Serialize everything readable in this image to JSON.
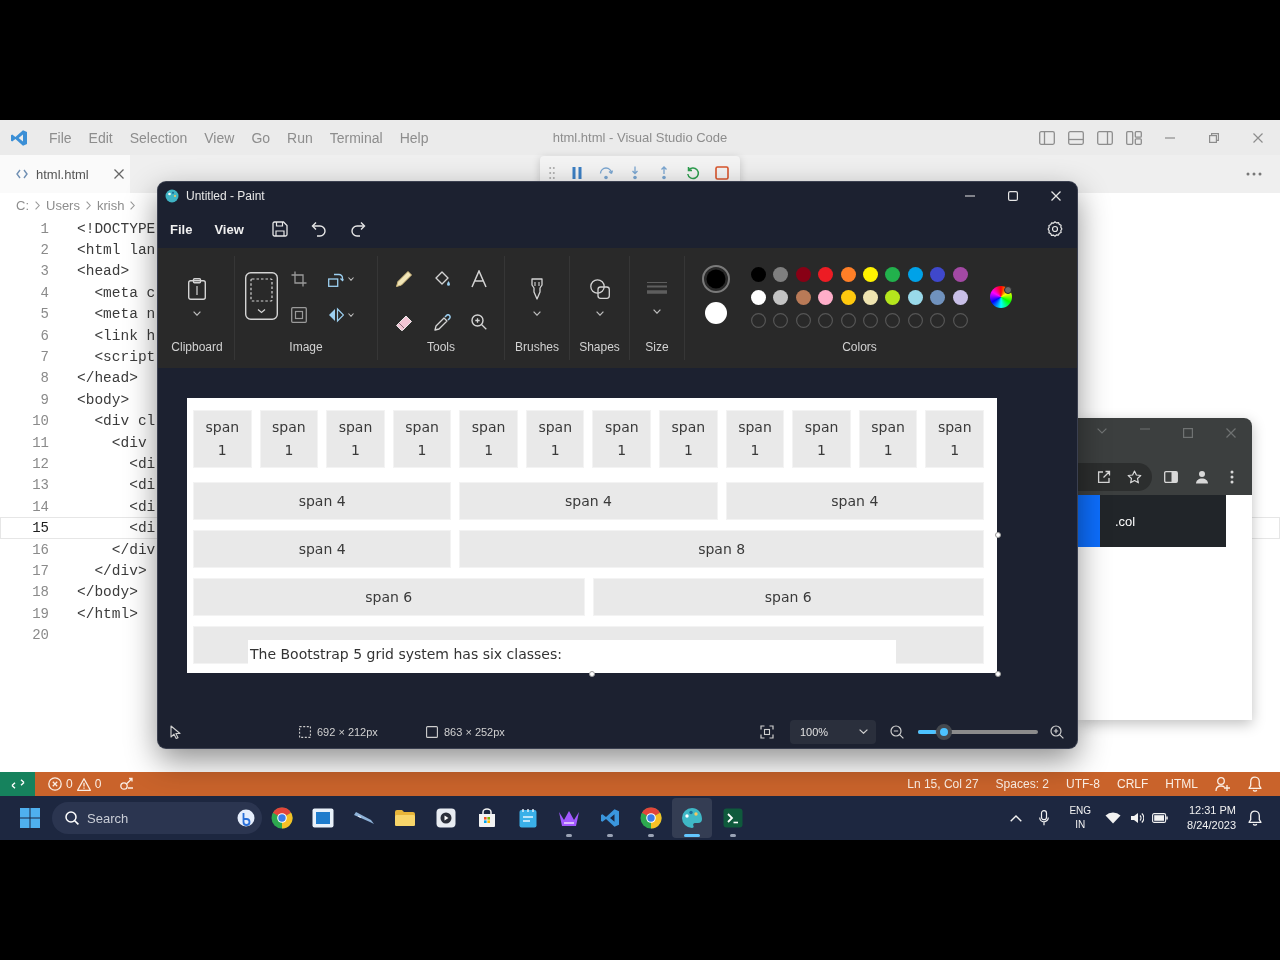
{
  "editor": {
    "menu": [
      "File",
      "Edit",
      "Selection",
      "View",
      "Go",
      "Run",
      "Terminal",
      "Help"
    ],
    "title": "html.html - Visual Studio Code",
    "tabs": [
      {
        "label": "html.html",
        "selected": true
      }
    ],
    "breadcrumb": [
      "C:",
      "Users",
      "krish"
    ],
    "lines": [
      {
        "number": "1",
        "code": "<!DOCTYPE",
        "current": false
      },
      {
        "number": "2",
        "code": "<html lan",
        "current": false
      },
      {
        "number": "3",
        "code": "<head>",
        "current": false,
        "children": [
          {
            "number": "4",
            "code": "<meta c",
            "current": false
          },
          {
            "number": "5",
            "code": "<meta n",
            "current": false
          },
          {
            "number": "6",
            "code": "<link h",
            "current": false
          },
          {
            "number": "7",
            "code": "<script",
            "current": false
          }
        ]
      },
      {
        "number": "8",
        "code": "</head>",
        "current": false
      },
      {
        "number": "9",
        "code": "<body>",
        "current": false,
        "children": [
          {
            "number": "10",
            "code": "<div cl",
            "current": false,
            "children": [
              {
                "number": "11",
                "code": "<div",
                "current": false,
                "children": [
                  {
                    "number": "12",
                    "code": "<di",
                    "current": false
                  },
                  {
                    "number": "13",
                    "code": "<di",
                    "current": false
                  },
                  {
                    "number": "14",
                    "code": "<di",
                    "current": false
                  },
                  {
                    "number": "15",
                    "code": "<di",
                    "current": true
                  }
                ]
              },
              {
                "number": "16",
                "code": "</div",
                "current": false
              }
            ]
          },
          {
            "number": "17",
            "code": "</div>",
            "current": false
          }
        ]
      },
      {
        "number": "18",
        "code": "</body>",
        "current": false
      },
      {
        "number": "19",
        "code": "</html>",
        "current": false
      },
      {
        "number": "20",
        "current": false
      }
    ],
    "status_bar": {
      "errors": "0",
      "warnings": "0",
      "items": [
        "Ln 15, Col 27",
        "Spaces: 2",
        "UTF-8",
        "CRLF",
        "HTML"
      ]
    }
  },
  "browser": {
    "column_label": ".col"
  },
  "paint": {
    "title": "Untitled - Paint",
    "menu": [
      "File",
      "View"
    ],
    "groups": [
      {
        "kind": "clipboard",
        "label": "Clipboard"
      },
      {
        "kind": "image",
        "label": "Image"
      },
      {
        "kind": "tools",
        "label": "Tools"
      },
      {
        "kind": "brushes",
        "label": "Brushes"
      },
      {
        "kind": "shapes",
        "label": "Shapes"
      },
      {
        "kind": "size",
        "label": "Size"
      },
      {
        "kind": "colors",
        "label": "Colors"
      }
    ],
    "primary_color": {
      "color": "#000000",
      "selected": true
    },
    "secondary_color": {
      "color": "#ffffff",
      "selected": false
    },
    "palette": [
      {
        "kind": "swatch",
        "color": "#000000"
      },
      {
        "kind": "swatch",
        "color": "#7f7f7f"
      },
      {
        "kind": "swatch",
        "color": "#880015"
      },
      {
        "kind": "swatch",
        "color": "#ed1c24"
      },
      {
        "kind": "swatch",
        "color": "#ff7f27"
      },
      {
        "kind": "swatch",
        "color": "#fff200"
      },
      {
        "kind": "swatch",
        "color": "#22b14c"
      },
      {
        "kind": "swatch",
        "color": "#00a2e8"
      },
      {
        "kind": "swatch",
        "color": "#3f48cc"
      },
      {
        "kind": "swatch",
        "color": "#a349a4"
      },
      {
        "kind": "swatch",
        "color": "#ffffff"
      },
      {
        "kind": "swatch",
        "color": "#c3c3c3"
      },
      {
        "kind": "swatch",
        "color": "#b97a57"
      },
      {
        "kind": "swatch",
        "color": "#ffaec9"
      },
      {
        "kind": "swatch",
        "color": "#ffc90e"
      },
      {
        "kind": "swatch",
        "color": "#efe4b0"
      },
      {
        "kind": "swatch",
        "color": "#b5e61d"
      },
      {
        "kind": "swatch",
        "color": "#99d9ea"
      },
      {
        "kind": "swatch",
        "color": "#7092be"
      },
      {
        "kind": "swatch",
        "color": "#c8bfe7"
      },
      {
        "kind": "empty"
      },
      {
        "kind": "empty"
      },
      {
        "kind": "empty"
      },
      {
        "kind": "empty"
      },
      {
        "kind": "empty"
      },
      {
        "kind": "empty"
      },
      {
        "kind": "empty"
      },
      {
        "kind": "empty"
      },
      {
        "kind": "empty"
      },
      {
        "kind": "empty"
      }
    ],
    "canvas": {
      "rows": [
        {
          "kind": "cells",
          "cells": [
            "span 1",
            "span 1",
            "span 1",
            "span 1",
            "span 1",
            "span 1",
            "span 1",
            "span 1",
            "span 1",
            "span 1",
            "span 1",
            "span 1"
          ]
        },
        {
          "kind": "cells",
          "cells": [
            "span 4",
            "span 4",
            "span 4"
          ]
        },
        {
          "kind": "cells",
          "cells": [
            "span 4",
            "span 8"
          ]
        },
        {
          "kind": "cells",
          "cells": [
            "span 6",
            "span 6"
          ]
        },
        {
          "kind": "blank"
        }
      ],
      "text_box": "The Bootstrap 5 grid system has six classes:"
    },
    "status_bar": {
      "selection_size": "692 × 212px",
      "canvas_size": "863 × 252px",
      "zoom": "100%",
      "zoom_slider": {
        "level": 0.15
      }
    }
  },
  "taskbar": {
    "search": {
      "placeholder": "Search"
    },
    "apps": [
      {
        "kind": "browser",
        "running": false,
        "selected": false
      },
      {
        "kind": "window",
        "running": false,
        "selected": false
      },
      {
        "kind": "pen",
        "running": false,
        "selected": false
      },
      {
        "kind": "folder",
        "running": false,
        "selected": false
      },
      {
        "kind": "media",
        "running": false,
        "selected": false
      },
      {
        "kind": "store",
        "running": false,
        "selected": false
      },
      {
        "kind": "notepad",
        "running": false,
        "selected": false
      },
      {
        "kind": "crown",
        "running": true,
        "selected": false
      },
      {
        "kind": "editor",
        "running": true,
        "selected": false
      },
      {
        "kind": "browser",
        "running": true,
        "selected": false
      },
      {
        "kind": "palette",
        "running": true,
        "selected": true
      },
      {
        "kind": "terminal",
        "running": true,
        "selected": false
      }
    ],
    "language": "ENG",
    "region": "IN",
    "time": "12:31 PM",
    "date": "8/24/2023"
  }
}
